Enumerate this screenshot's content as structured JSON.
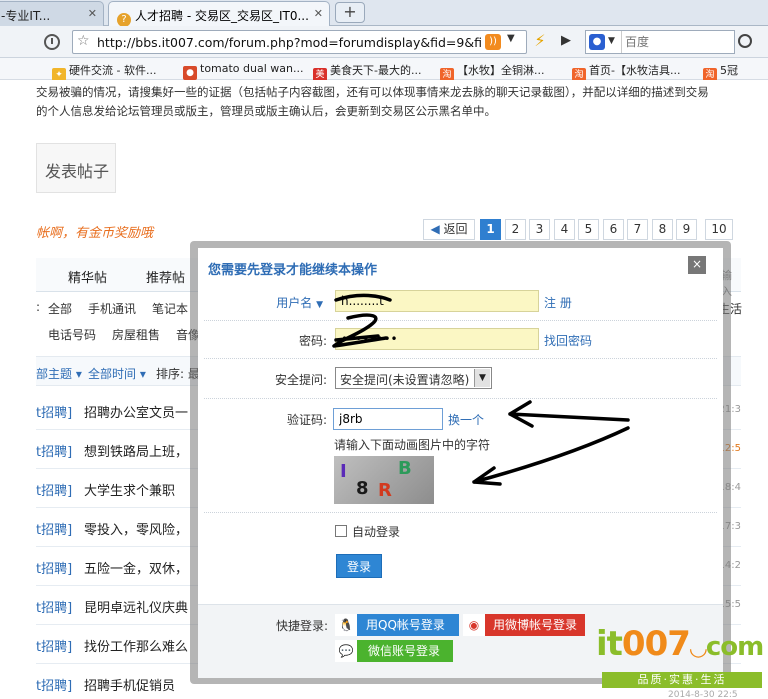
{
  "browser": {
    "tabs": [
      {
        "label": "-专业IT...",
        "active": false
      },
      {
        "label": "人才招聘 - 交易区_交易区_IT0...",
        "active": true
      }
    ],
    "new_tab": "+",
    "url": "http://bbs.it007.com/forum.php?mod=forumdisplay&fid=9&fil",
    "search_placeholder": "百度",
    "bookmarks": [
      "硬件交流 - 软件...",
      "tomato dual wan...",
      "美食天下-最大的...",
      "【水牧】全铜淋...",
      "首页-【水牧洁具...",
      "5冠"
    ]
  },
  "page": {
    "notice_lines": [
      "交易被骗的情况，请搜集好一些的证据（包括帖子内容截图，还有可以体现事情来龙去脉的聊天记录截图），并配以详细的描述到交易",
      "的个人信息发给论坛管理员或版主，管理员或版主确认后，会更新到交易区公示黑名单中。"
    ],
    "post_button": "发表帖子",
    "slogan": "帐啊，有金币奖励哦",
    "pager": {
      "back": "返回",
      "pages": [
        "1",
        "2",
        "3",
        "4",
        "5",
        "6",
        "7",
        "8",
        "9",
        "10"
      ],
      "current": "1"
    },
    "tabs": [
      "精华帖",
      "推荐帖"
    ],
    "tab_search_hint": "输入",
    "cat_row1": [
      "全部",
      "手机通讯",
      "笔记本",
      "生活"
    ],
    "cat_row2": [
      "电话号码",
      "房屋租售",
      "音像"
    ],
    "filters": [
      "部主题",
      "全部时间",
      "排序: 最"
    ],
    "threads": [
      {
        "tag": "t招聘]",
        "title": "招聘办公室文员一",
        "time": "21:3"
      },
      {
        "tag": "t招聘]",
        "title": "想到铁路局上班，",
        "time": "12:5"
      },
      {
        "tag": "t招聘]",
        "title": "大学生求个兼职",
        "time": "18:4"
      },
      {
        "tag": "t招聘]",
        "title": "零投入，零风险，",
        "time": "17:3"
      },
      {
        "tag": "t招聘]",
        "title": "五险一金，双休，",
        "time": "14:2"
      },
      {
        "tag": "t招聘]",
        "title": "昆明卓远礼仪庆典",
        "time": "15:5"
      },
      {
        "tag": "t招聘]",
        "title": "找份工作那么难么",
        "time": ""
      },
      {
        "tag": "t招聘]",
        "title": "招聘手机促销员",
        "time": ""
      }
    ]
  },
  "modal": {
    "title": "您需要先登录才能继续本操作",
    "close": "×",
    "username_label": "用户名",
    "username_value": "h........t",
    "register_link": "注 册",
    "password_label": "密码:",
    "password_value": "••••••••",
    "forgot_link": "找回密码",
    "question_label": "安全提问:",
    "question_value": "安全提问(未设置请忽略)",
    "captcha_label": "验证码:",
    "captcha_value": "j8rb",
    "captcha_refresh": "换一个",
    "captcha_hint": "请输入下面动画图片中的字符",
    "captcha_chars": [
      "I",
      "8",
      "R",
      "B"
    ],
    "auto_login_label": "自动登录",
    "login_button": "登录",
    "quick_login_label": "快捷登录:",
    "qq_login": "用QQ帐号登录",
    "weibo_login": "用微博帐号登录",
    "wechat_login": "微信账号登录"
  },
  "logo": {
    "main_prefix": "it",
    "main_mid": "007",
    "main_suffix": "com",
    "sub": "品质·实惠·生活",
    "date": "2014-8-30 22:5"
  }
}
